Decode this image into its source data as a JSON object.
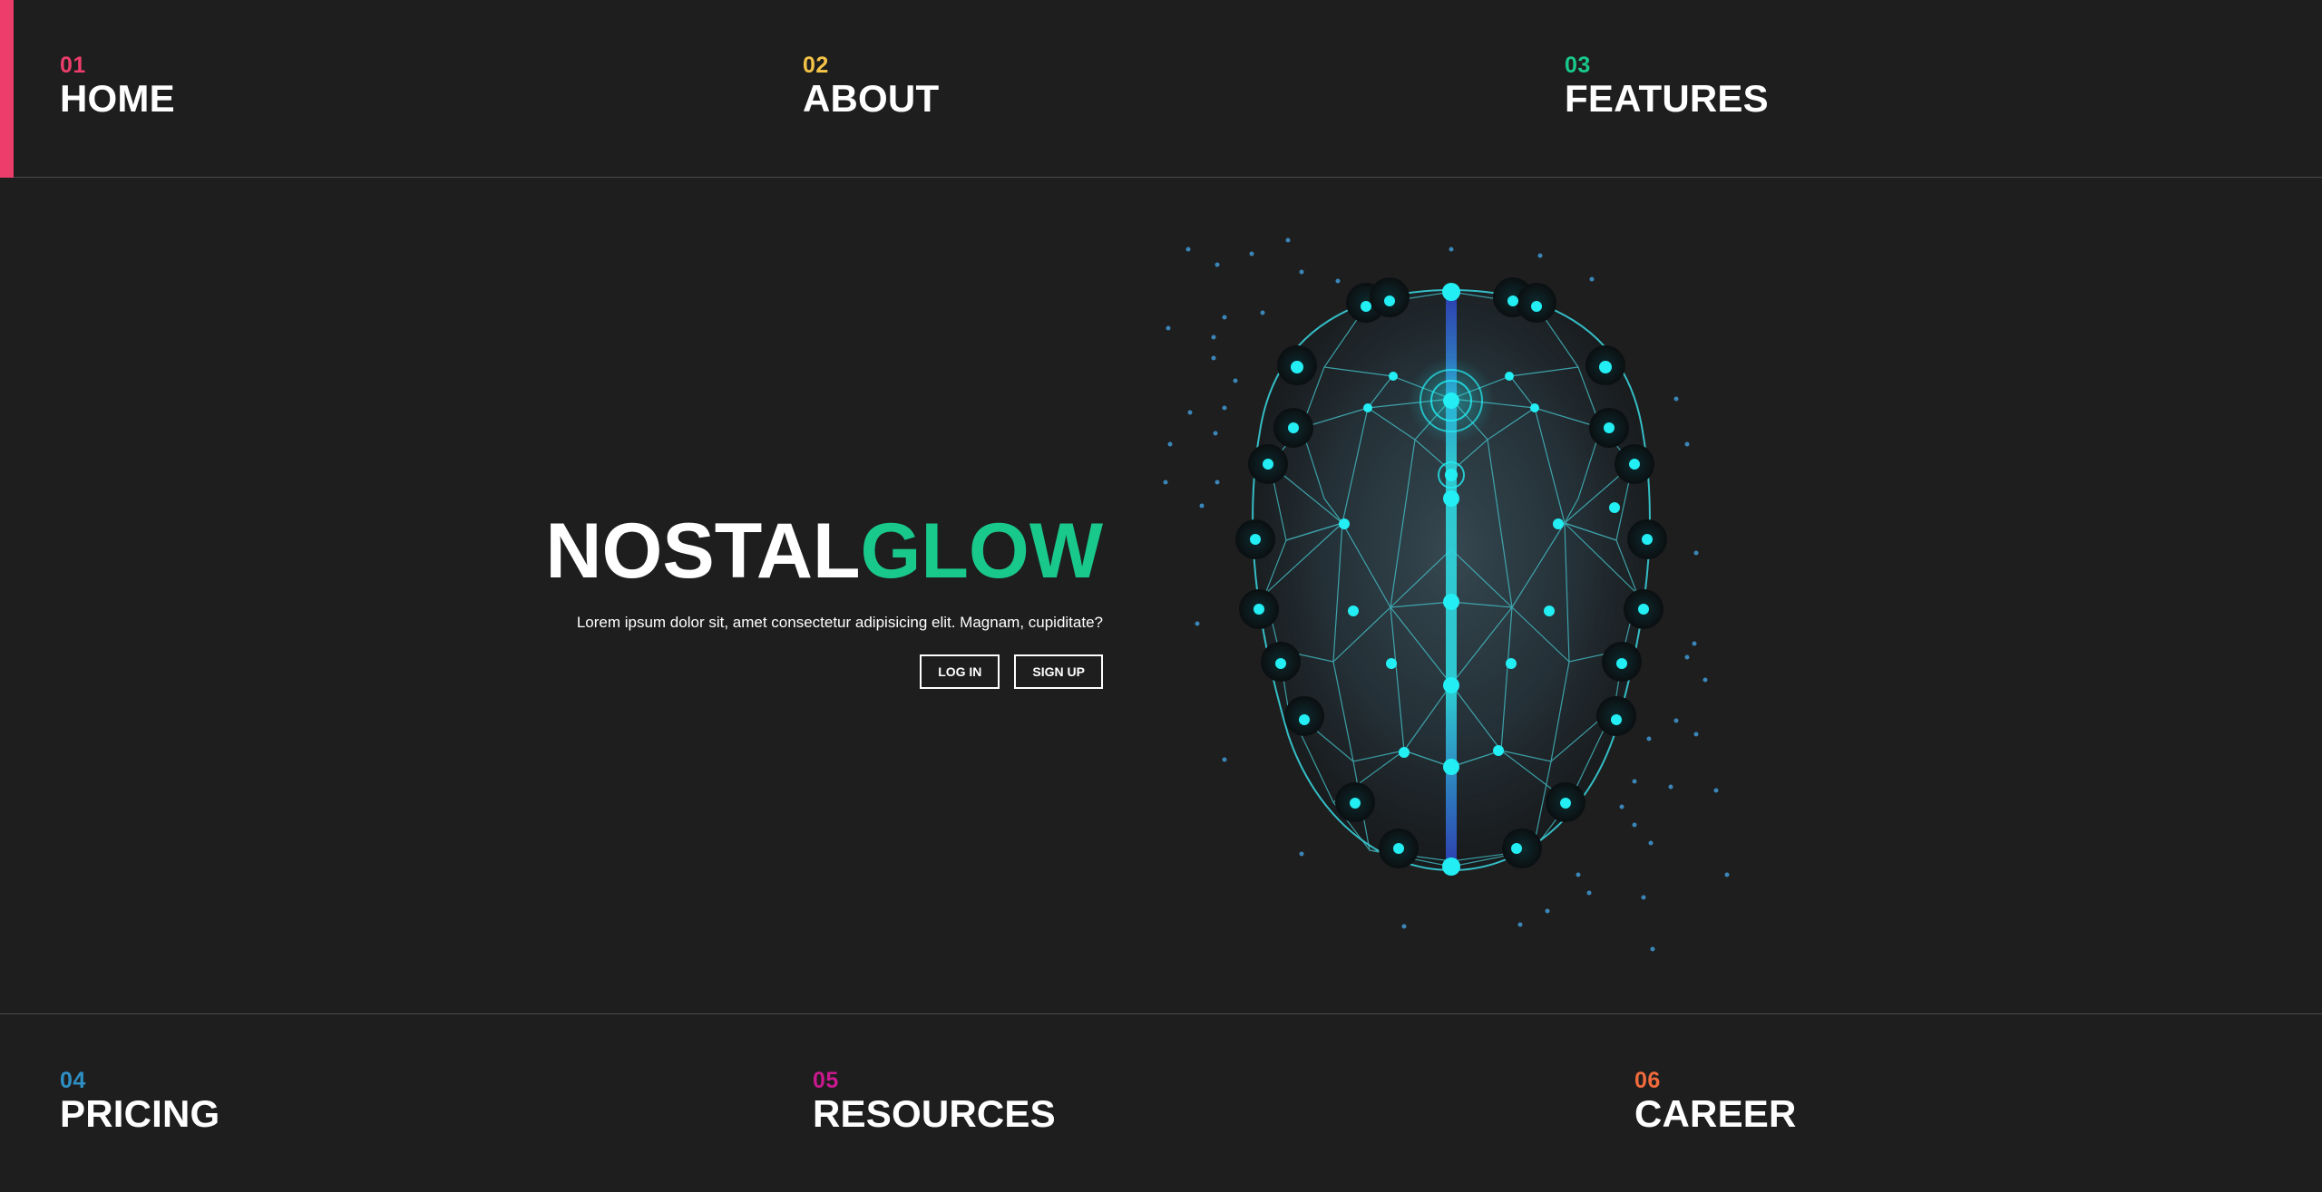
{
  "nav": {
    "top": [
      {
        "num": "01",
        "label": "HOME",
        "color": "#ec3d6b"
      },
      {
        "num": "02",
        "label": "ABOUT",
        "color": "#f5c447"
      },
      {
        "num": "03",
        "label": "FEATURES",
        "color": "#19c98c"
      }
    ],
    "bottom": [
      {
        "num": "04",
        "label": "PRICING",
        "color": "#2e8fc4"
      },
      {
        "num": "05",
        "label": "RESOURCES",
        "color": "#c8198f"
      },
      {
        "num": "06",
        "label": "CAREER",
        "color": "#f06a3c"
      }
    ]
  },
  "hero": {
    "title_part1": "NOSTAL",
    "title_part2": "GLOW",
    "title_accent_color": "#19c98c",
    "description": "Lorem ipsum dolor sit, amet consectetur adipisicing elit. Magnam, cupiditate?",
    "login_label": "LOG IN",
    "signup_label": "SIGN UP"
  },
  "illustration": {
    "icon": "glowing-face-mesh",
    "accent": "#1fe0e6"
  }
}
